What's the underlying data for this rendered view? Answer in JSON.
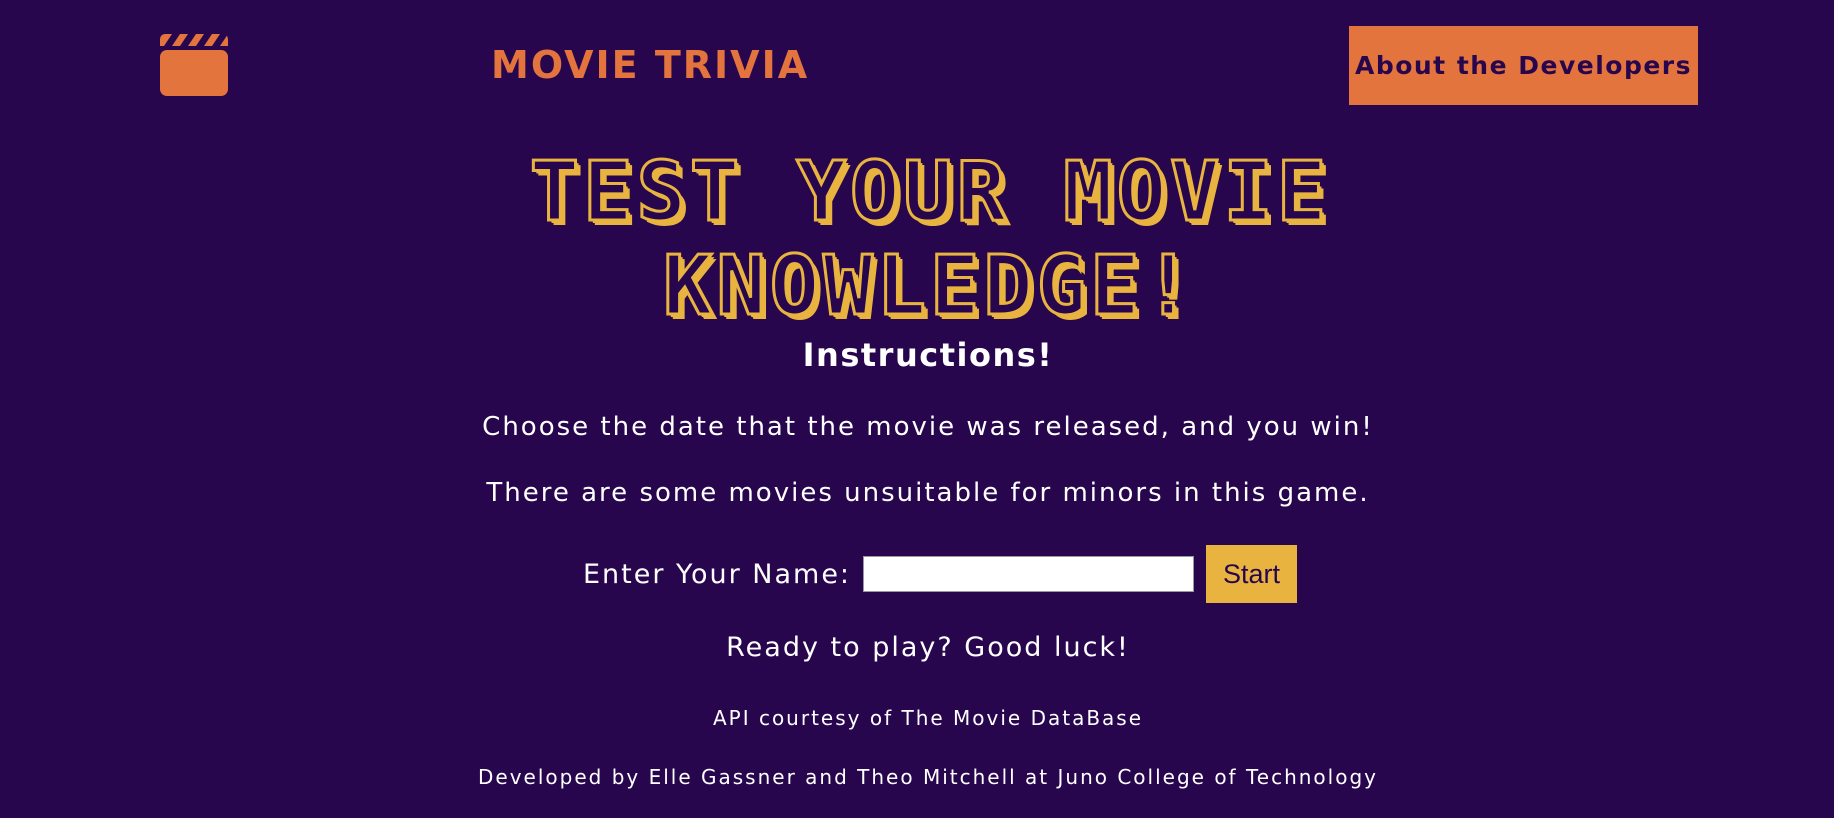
{
  "header": {
    "logo_icon": "clapperboard-icon",
    "title": "MOVIE TRIVIA",
    "about_button_label": "About the Developers"
  },
  "hero": {
    "line1": "TEST YOUR MOVIE",
    "line2": "KNOWLEDGE!"
  },
  "instructions": {
    "title": "Instructions!",
    "line1": "Choose the date that the movie was released, and you win!",
    "line2": "There are some movies unsuitable for minors in this game."
  },
  "form": {
    "name_label": "Enter Your Name:",
    "name_value": "",
    "start_label": "Start"
  },
  "ready_text": "Ready to play? Good luck!",
  "footer": {
    "api_credit": "API courtesy of The Movie DataBase",
    "developed_by": "Developed by Elle Gassner and Theo Mitchell at Juno College of Technology"
  },
  "colors": {
    "background": "#28064e",
    "accent_orange": "#e4743e",
    "accent_yellow": "#e8b43f",
    "text": "#ffffff"
  }
}
